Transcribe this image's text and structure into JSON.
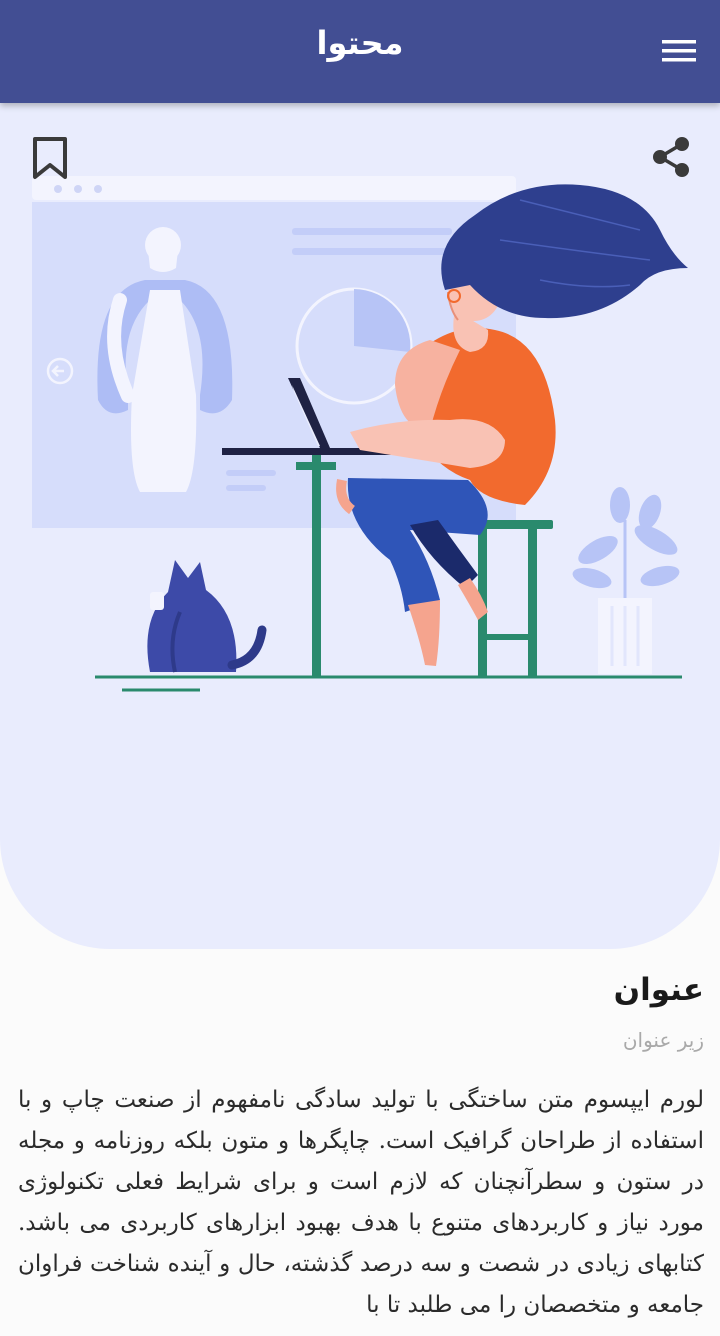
{
  "appbar": {
    "title": "محتوا",
    "menu_icon": "hamburger-menu-icon"
  },
  "actions": {
    "bookmark_icon": "bookmark-icon",
    "share_icon": "share-icon"
  },
  "hero": {
    "illustration": "woman-working-on-laptop-with-cat"
  },
  "content": {
    "title": "عنوان",
    "subtitle": "زیر عنوان",
    "body": "لورم ایپسوم متن ساختگی با تولید سادگی نامفهوم از صنعت چاپ و با استفاده از طراحان گرافیک است. چاپگرها و متون بلکه روزنامه و مجله در ستون و سطرآنچنان که لازم است و برای شرایط فعلی تکنولوژی مورد نیاز و کاربردهای متنوع با هدف بهبود ابزارهای کاربردی می باشد. کتابهای زیادی در شصت و سه درصد گذشته، حال و آینده شناخت فراوان جامعه و متخصصان را می طلبد تا با"
  },
  "colors": {
    "appbar": "#424e93",
    "hero_bg": "#e9ecfd",
    "accent_orange": "#f26a2e",
    "jeans": "#2f55b8",
    "hair": "#2e3f8e"
  }
}
